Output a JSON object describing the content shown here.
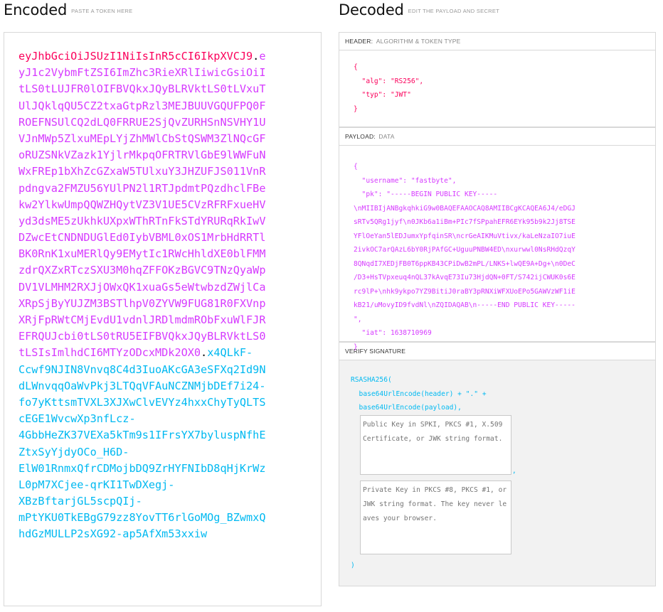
{
  "encoded": {
    "title": "Encoded",
    "subtitle": "PASTE A TOKEN HERE",
    "token_lines": [
      [
        {
          "t": "eyJhbGciOiJSUzI1NiIsInR5cCI6IkpXVCJ9",
          "c": "header"
        },
        {
          "t": ".",
          "c": "dot"
        },
        {
          "t": "e",
          "c": "payload"
        }
      ],
      [
        {
          "t": "yJ1c2VybmFtZSI6ImZhc3RieXRlIiwicGsiOiI",
          "c": "payload"
        }
      ],
      [
        {
          "t": "tLS0tLUJFR0lOIFBVQkxJQyBLRVktLS0tLVxuT",
          "c": "payload"
        }
      ],
      [
        {
          "t": "UlJQklqQU5CZ2txaGtpRzl3MEJBUUVGQUFPQ0F",
          "c": "payload"
        }
      ],
      [
        {
          "t": "ROEFNSUlCQ2dLQ0FRRUE2SjQvZURHSnNSVHY1U",
          "c": "payload"
        }
      ],
      [
        {
          "t": "VJnMWp5ZlxuMEpLYjZhMWlCbStQSWM3ZlNQcGF",
          "c": "payload"
        }
      ],
      [
        {
          "t": "oRUZSNkVZazk1YjlrMkpqOFRTRVlGbE9lWWFuN",
          "c": "payload"
        }
      ],
      [
        {
          "t": "WxFREp1bXhZcGZxaW5TUlxuY3JHZUFJS011VnR",
          "c": "payload"
        }
      ],
      [
        {
          "t": "pdngva2FMZU56YUlPN2l1RTJpdmtPQzdhclFBe",
          "c": "payload"
        }
      ],
      [
        {
          "t": "kw2YlkwUmpQQWZHQytVZ3V1UE5CVzRFRFxueHV",
          "c": "payload"
        }
      ],
      [
        {
          "t": "yd3dsME5zUkhkUXpxWThRTnFkSTdYRURqRkIwV",
          "c": "payload"
        }
      ],
      [
        {
          "t": "DZwcEtCNDNDUGlEd0IybVBML0xOS1MrbHdRRTl",
          "c": "payload"
        }
      ],
      [
        {
          "t": "BK0RnK1xuMERlQy9EMytIc1RWcHhldXE0blFMM",
          "c": "payload"
        }
      ],
      [
        {
          "t": "zdrQXZxRTczSXU3M0hqZFFOKzBGVC9TNzQyaWp",
          "c": "payload"
        }
      ],
      [
        {
          "t": "DV1VLMHM2RXJjOWxQK1xuaGs5eWtwbzdZWjlCa",
          "c": "payload"
        }
      ],
      [
        {
          "t": "XRpSjByYUJZM3BSTlhpV0ZYVW9FUG81R0FXVnp",
          "c": "payload"
        }
      ],
      [
        {
          "t": "XRjFpRWtCMjEvdU1vdnlJRDlmdmRObFxuWlFJR",
          "c": "payload"
        }
      ],
      [
        {
          "t": "EFRQUJcbi0tLS0tRU5EIFBVQkxJQyBLRVktLS0",
          "c": "payload"
        }
      ],
      [
        {
          "t": "tLSIsImlhdCI6MTYzODcxMDk2OX0",
          "c": "payload"
        },
        {
          "t": ".",
          "c": "dot"
        },
        {
          "t": "x4QLkF-",
          "c": "sig"
        }
      ],
      [
        {
          "t": "Ccwf9NJIN8Vnvq8C4d3IuoAKcGA3eSFXq2Id9N",
          "c": "sig"
        }
      ],
      [
        {
          "t": "dLWnvqqOaWvPkj3LTQqVFAuNCZNMjbDEf7i24-",
          "c": "sig"
        }
      ],
      [
        {
          "t": "fo7yKttsmTVXL3XJXwClvEVYz4hxxChyTyQLTS",
          "c": "sig"
        }
      ],
      [
        {
          "t": "cEGE1WvcwXp3nfLcz-",
          "c": "sig"
        }
      ],
      [
        {
          "t": "4GbbHeZK37VEXa5kTm9s1IFrsYX7byluspNfhE",
          "c": "sig"
        }
      ],
      [
        {
          "t": "ZtxSyYjdyOCo_H6D-",
          "c": "sig"
        }
      ],
      [
        {
          "t": "ElW01RnmxQfrCDMojbDQ9ZrHYFNIbD8qHjKrWz",
          "c": "sig"
        }
      ],
      [
        {
          "t": "L0pM7XCjee-qrKI1TwDXegj-",
          "c": "sig"
        }
      ],
      [
        {
          "t": "XBzBftarjGL5scpQIj-",
          "c": "sig"
        }
      ],
      [
        {
          "t": "mPtYKU0TkEBgG79zz8YovTT6rlGoMOg_BZwmxQ",
          "c": "sig"
        }
      ],
      [
        {
          "t": "hdGzMULLP2sXG92-ap5AfXm53xxiw",
          "c": "sig"
        }
      ]
    ]
  },
  "decoded": {
    "title": "Decoded",
    "subtitle": "EDIT THE PAYLOAD AND SECRET",
    "header": {
      "label": "HEADER:",
      "sublabel": "ALGORITHM & TOKEN TYPE",
      "lines": [
        "{",
        "  \"alg\": \"RS256\",",
        "  \"typ\": \"JWT\"",
        "}"
      ]
    },
    "payload": {
      "label": "PAYLOAD:",
      "sublabel": "DATA",
      "lines": [
        "{",
        "  \"username\": \"fastbyte\",",
        "  \"pk\": \"-----BEGIN PUBLIC KEY-----",
        "\\nMIIBIjANBgkqhkiG9w0BAQEFAAOCAQ8AMIIBCgKCAQEA6J4/eDGJ",
        "sRTv5QRg1jyf\\n0JKb6a1iBm+PIc7fSPpahEFR6EYk95b9k2Jj8TSE",
        "YFlOeYan5lEDJumxYpfqinSR\\ncrGeAIKMuVtivx/kaLeNzaIO7iuE",
        "2ivkOC7arQAzL6bY0RjPAfGC+UguuPNBW4ED\\nxurwwl0NsRHdQzqY",
        "8QNqdI7XEDjFB0T6ppKB43CPiDwB2mPL/LNKS+lwQE9A+Dg+\\n0DeC",
        "/D3+HsTVpxeuq4nQL37kAvqE73Iu73HjdQN+0FT/S742ijCWUK0s6E",
        "rc9lP+\\nhk9ykpo7YZ9BitiJ0raBY3pRNXiWFXUoEPo5GAWVzWF1iE",
        "kB21/uMovyID9fvdNl\\nZQIDAQAB\\n-----END PUBLIC KEY-----",
        "\",",
        "  \"iat\": 1638710969",
        "}"
      ]
    },
    "verify": {
      "label": "VERIFY SIGNATURE",
      "lines": [
        "RSASHA256(",
        "  base64UrlEncode(header) + \".\" +",
        "  base64UrlEncode(payload),"
      ],
      "public_key_placeholder": "Public Key in SPKI, PKCS #1, X.509 Certificate, or JWK string format.",
      "private_key_placeholder": "Private Key in PKCS #8, PKCS #1, or JWK string format. The key never leaves your browser.",
      "comma": ",",
      "close": ")"
    }
  }
}
